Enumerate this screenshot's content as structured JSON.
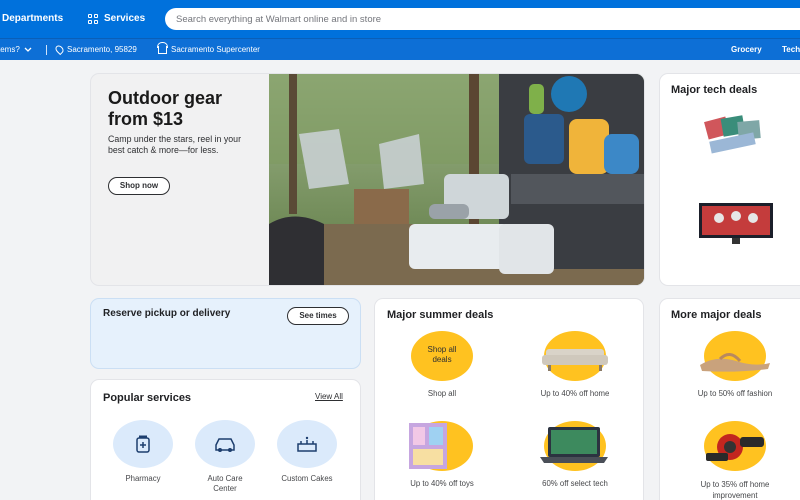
{
  "header": {
    "departments": "Departments",
    "services": "Services",
    "search_placeholder": "Search everything at Walmart online and in store"
  },
  "subbar": {
    "items_label": "tems?",
    "location": "Sacramento, 95829",
    "store": "Sacramento Supercenter",
    "grocery": "Grocery",
    "tech": "Tech"
  },
  "hero": {
    "title": "Outdoor gear from $13",
    "subtitle": "Camp under the stars, reel in your best catch & more—for less.",
    "cta": "Shop now"
  },
  "tech_deals": {
    "title": "Major tech deals"
  },
  "pickup": {
    "title": "Reserve pickup or delivery",
    "cta": "See times"
  },
  "popular": {
    "title": "Popular services",
    "view_all": "View All",
    "items": [
      {
        "label": "Pharmacy",
        "icon": "pharmacy-icon"
      },
      {
        "label": "Auto Care Center",
        "icon": "car-icon"
      },
      {
        "label": "Custom Cakes",
        "icon": "cake-icon"
      }
    ]
  },
  "summer": {
    "title": "Major summer deals",
    "items": [
      {
        "label": "Shop all",
        "badge": "Shop all deals"
      },
      {
        "label": "Up to 40% off home"
      },
      {
        "label": "Up to 40% off toys"
      },
      {
        "label": "60% off select tech"
      }
    ]
  },
  "more": {
    "title": "More major deals",
    "items": [
      {
        "label": "Up to 50% off fashion"
      },
      {
        "label": "Up to 35% off home improvement"
      }
    ]
  },
  "colors": {
    "brand": "#0071dc",
    "accent": "#ffc220",
    "light_blue": "#dbeafb"
  }
}
